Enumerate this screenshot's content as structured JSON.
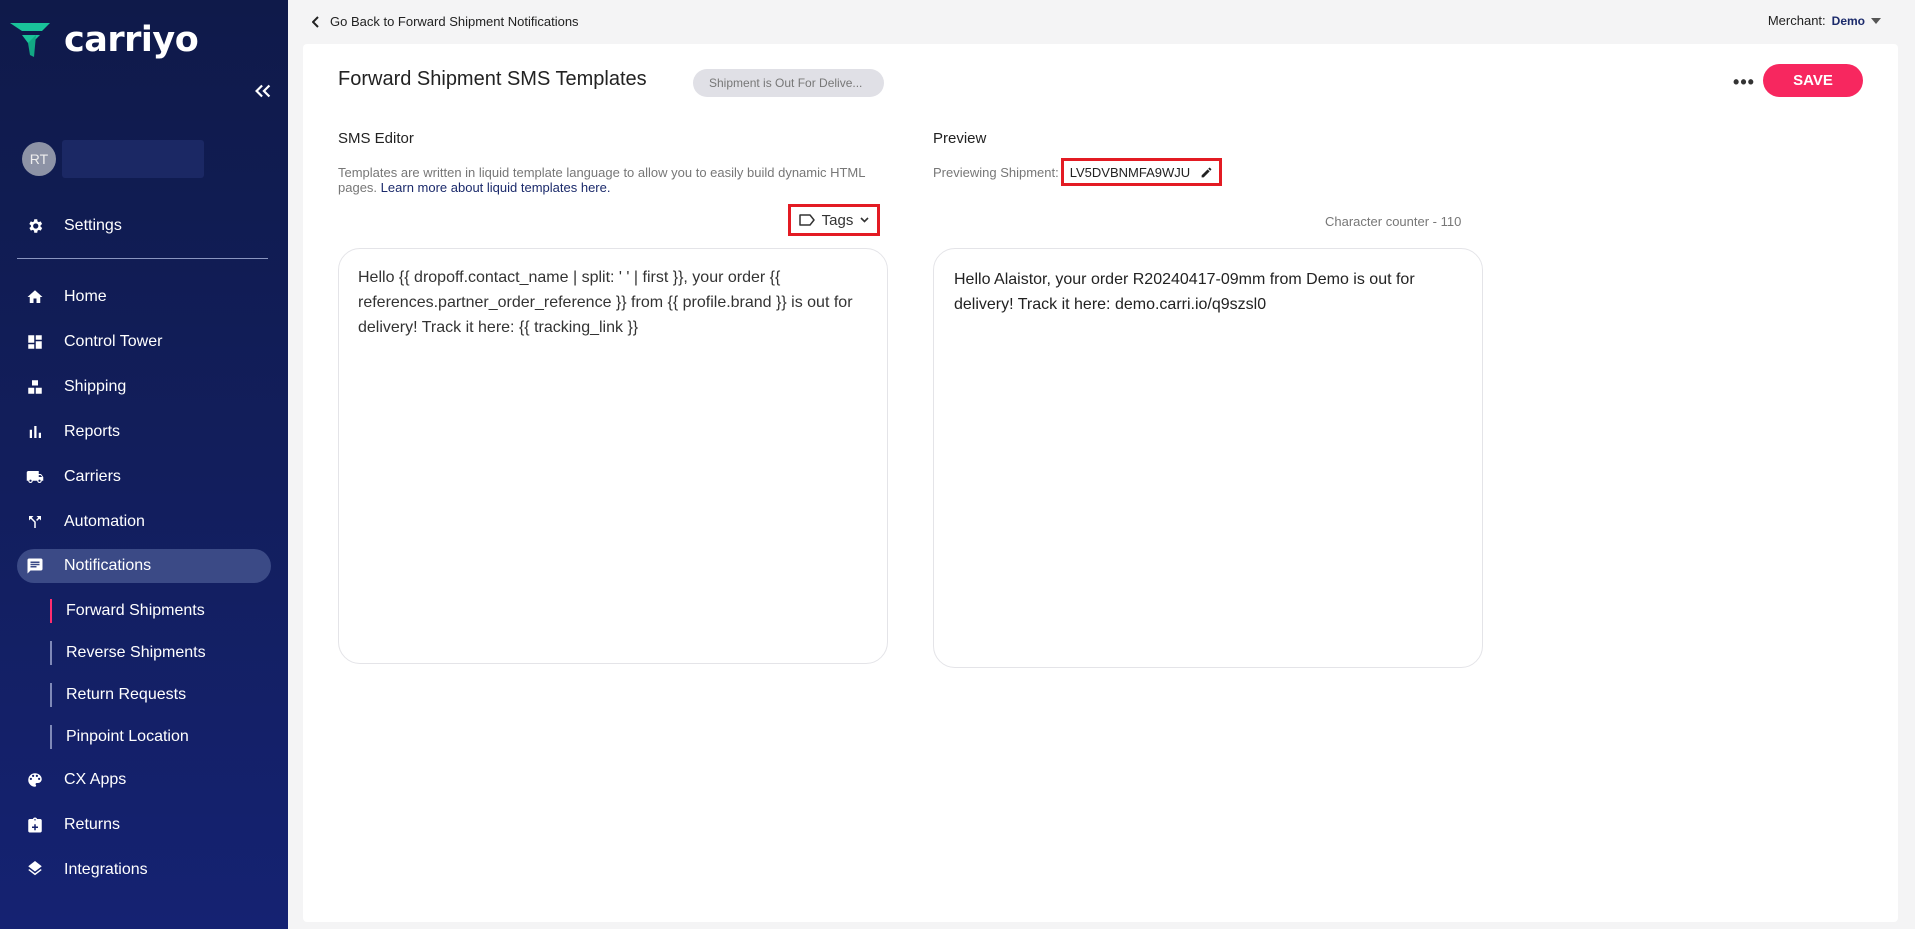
{
  "app": {
    "brand": "carriyo"
  },
  "user": {
    "initials": "RT"
  },
  "sidebar": {
    "settings_label": "Settings",
    "items": [
      {
        "label": "Home",
        "icon": "home-icon"
      },
      {
        "label": "Control Tower",
        "icon": "dashboard-icon"
      },
      {
        "label": "Shipping",
        "icon": "boxes-icon"
      },
      {
        "label": "Reports",
        "icon": "bar-chart-icon"
      },
      {
        "label": "Carriers",
        "icon": "truck-icon"
      },
      {
        "label": "Automation",
        "icon": "fork-icon"
      },
      {
        "label": "Notifications",
        "icon": "message-icon"
      },
      {
        "label": "CX Apps",
        "icon": "palette-icon"
      },
      {
        "label": "Returns",
        "icon": "return-box-icon"
      },
      {
        "label": "Integrations",
        "icon": "layers-icon"
      }
    ],
    "sub_items": [
      {
        "label": "Forward Shipments"
      },
      {
        "label": "Reverse Shipments"
      },
      {
        "label": "Return Requests"
      },
      {
        "label": "Pinpoint Location"
      }
    ]
  },
  "topbar": {
    "back_label": "Go Back to Forward Shipment Notifications",
    "merchant_label": "Merchant:",
    "merchant_value": "Demo"
  },
  "page": {
    "title": "Forward Shipment SMS Templates",
    "status_chip": "Shipment is Out For Delive...",
    "save_label": "SAVE"
  },
  "editor": {
    "heading": "SMS Editor",
    "help_text": "Templates are written in liquid template language to allow you to easily build dynamic HTML pages.",
    "help_link": "Learn more about liquid templates here.",
    "tags_label": "Tags",
    "content": "Hello {{ dropoff.contact_name | split: ' ' | first }}, your order {{ references.partner_order_reference }} from {{ profile.brand }} is out for delivery! Track it here: {{ tracking_link }}"
  },
  "preview": {
    "heading": "Preview",
    "previewing_label": "Previewing Shipment:",
    "shipment_id": "LV5DVBNMFA9WJU",
    "char_counter": "Character counter - 110",
    "content": "Hello Alaistor, your order R20240417-09mm from Demo is out for delivery! Track it here: demo.carri.io/q9szsl0"
  },
  "colors": {
    "sidebar_bg": "#121e5c",
    "accent": "#f7275f",
    "brand_green": "#19c39a",
    "highlight_border": "#e31b23"
  }
}
